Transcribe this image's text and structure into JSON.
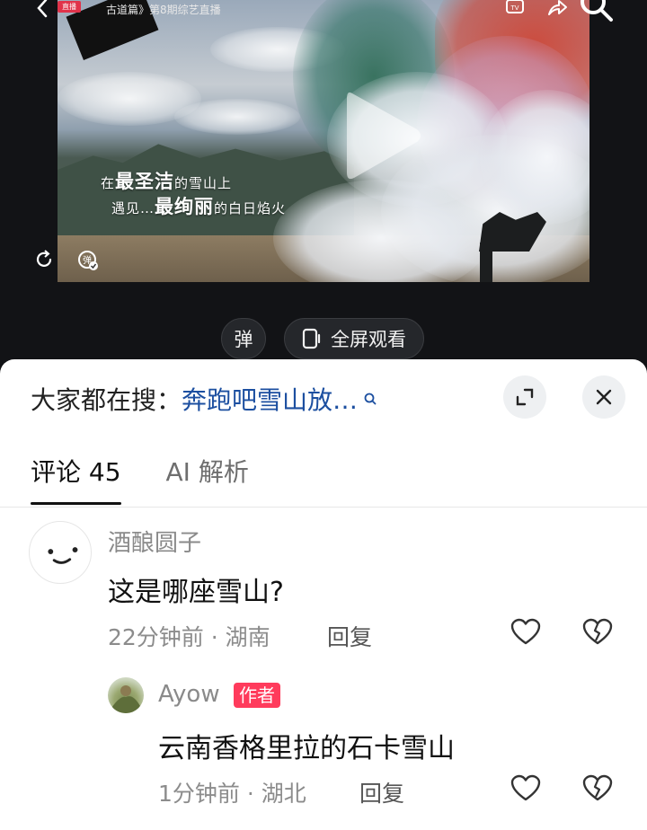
{
  "video": {
    "live_badge": "直播",
    "title": "古道篇》第8期综艺直播",
    "caption_line1_a": "在",
    "caption_line1_b": "最圣洁",
    "caption_line1_c": "的雪山上",
    "caption_line2_a": "遇见",
    "caption_line2_b": "最绚丽",
    "caption_line2_c": "的白日焰火"
  },
  "controls": {
    "danmaku_label": "弹",
    "fullscreen_label": "全屏观看"
  },
  "search_bar": {
    "prefix": "大家都在搜：",
    "query": "奔跑吧雪山放…"
  },
  "tabs": [
    {
      "label": "评论 45",
      "active": true
    },
    {
      "label": "AI 解析",
      "active": false
    }
  ],
  "comments": [
    {
      "user": "酒酿圆子",
      "text": "这是哪座雪山?",
      "time": "22分钟前",
      "location": "湖南",
      "reply_label": "回复"
    },
    {
      "user": "Ayow",
      "badge": "作者",
      "text": "云南香格里拉的石卡雪山",
      "time": "1分钟前",
      "location": "湖北",
      "reply_label": "回复"
    }
  ],
  "colors": {
    "link": "#1c4fa0",
    "author_badge": "#ff3b5c",
    "panel_bg": "#ffffff",
    "page_bg": "#101114"
  }
}
